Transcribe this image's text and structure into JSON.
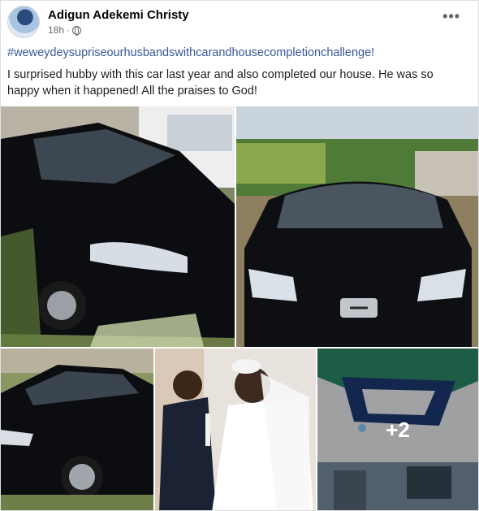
{
  "post": {
    "author": "Adigun Adekemi Christy",
    "time": "18h",
    "time_separator": "·",
    "privacy_icon": "globe-icon",
    "more_icon": "more-options-icon",
    "more_label": "•••",
    "hashtag": "#weweydeysupriseourhusbandswithcarandhousecompletionchallenge!",
    "text": "I surprised hubby with this car last year and also completed our house. He was so happy when it happened! All the praises to God!",
    "extra_photos_label": "+2"
  },
  "photos": [
    {
      "name": "black-peugeot-side-photo"
    },
    {
      "name": "black-peugeot-front-photo"
    },
    {
      "name": "black-peugeot-rear-photo"
    },
    {
      "name": "wedding-couple-photo"
    },
    {
      "name": "house-ceiling-photo"
    }
  ],
  "colors": {
    "link": "#385898",
    "text": "#1c1e21",
    "meta": "#65676b"
  }
}
